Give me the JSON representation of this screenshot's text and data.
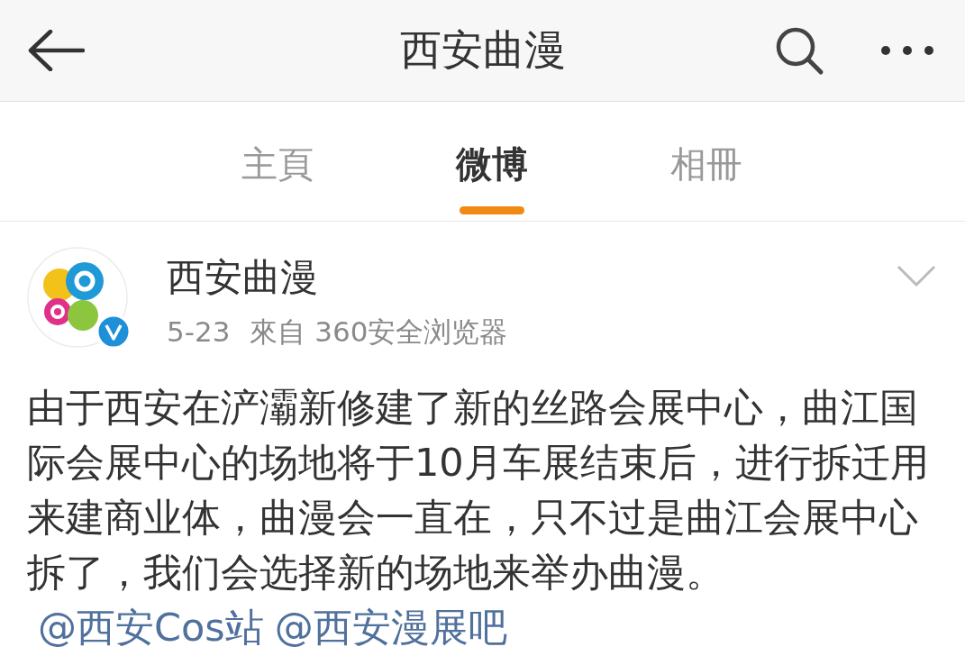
{
  "header": {
    "title": "西安曲漫"
  },
  "tabs": [
    {
      "label": "主頁",
      "selected": false
    },
    {
      "label": "微博",
      "selected": true
    },
    {
      "label": "相冊",
      "selected": false
    }
  ],
  "post": {
    "author": "西安曲漫",
    "verified": true,
    "date": "5-23",
    "source": "來自 360安全浏览器",
    "text": "由于西安在浐灞新修建了新的丝路会展中心，曲江国际会展中心的场地将于10月车展结束后，进行拆迁用来建商业体，曲漫会一直在，只不过是曲江会展中心拆了，我们会选择新的场地来举办曲漫。",
    "mentions": [
      "@西安Cos站",
      "@西安漫展吧"
    ]
  }
}
